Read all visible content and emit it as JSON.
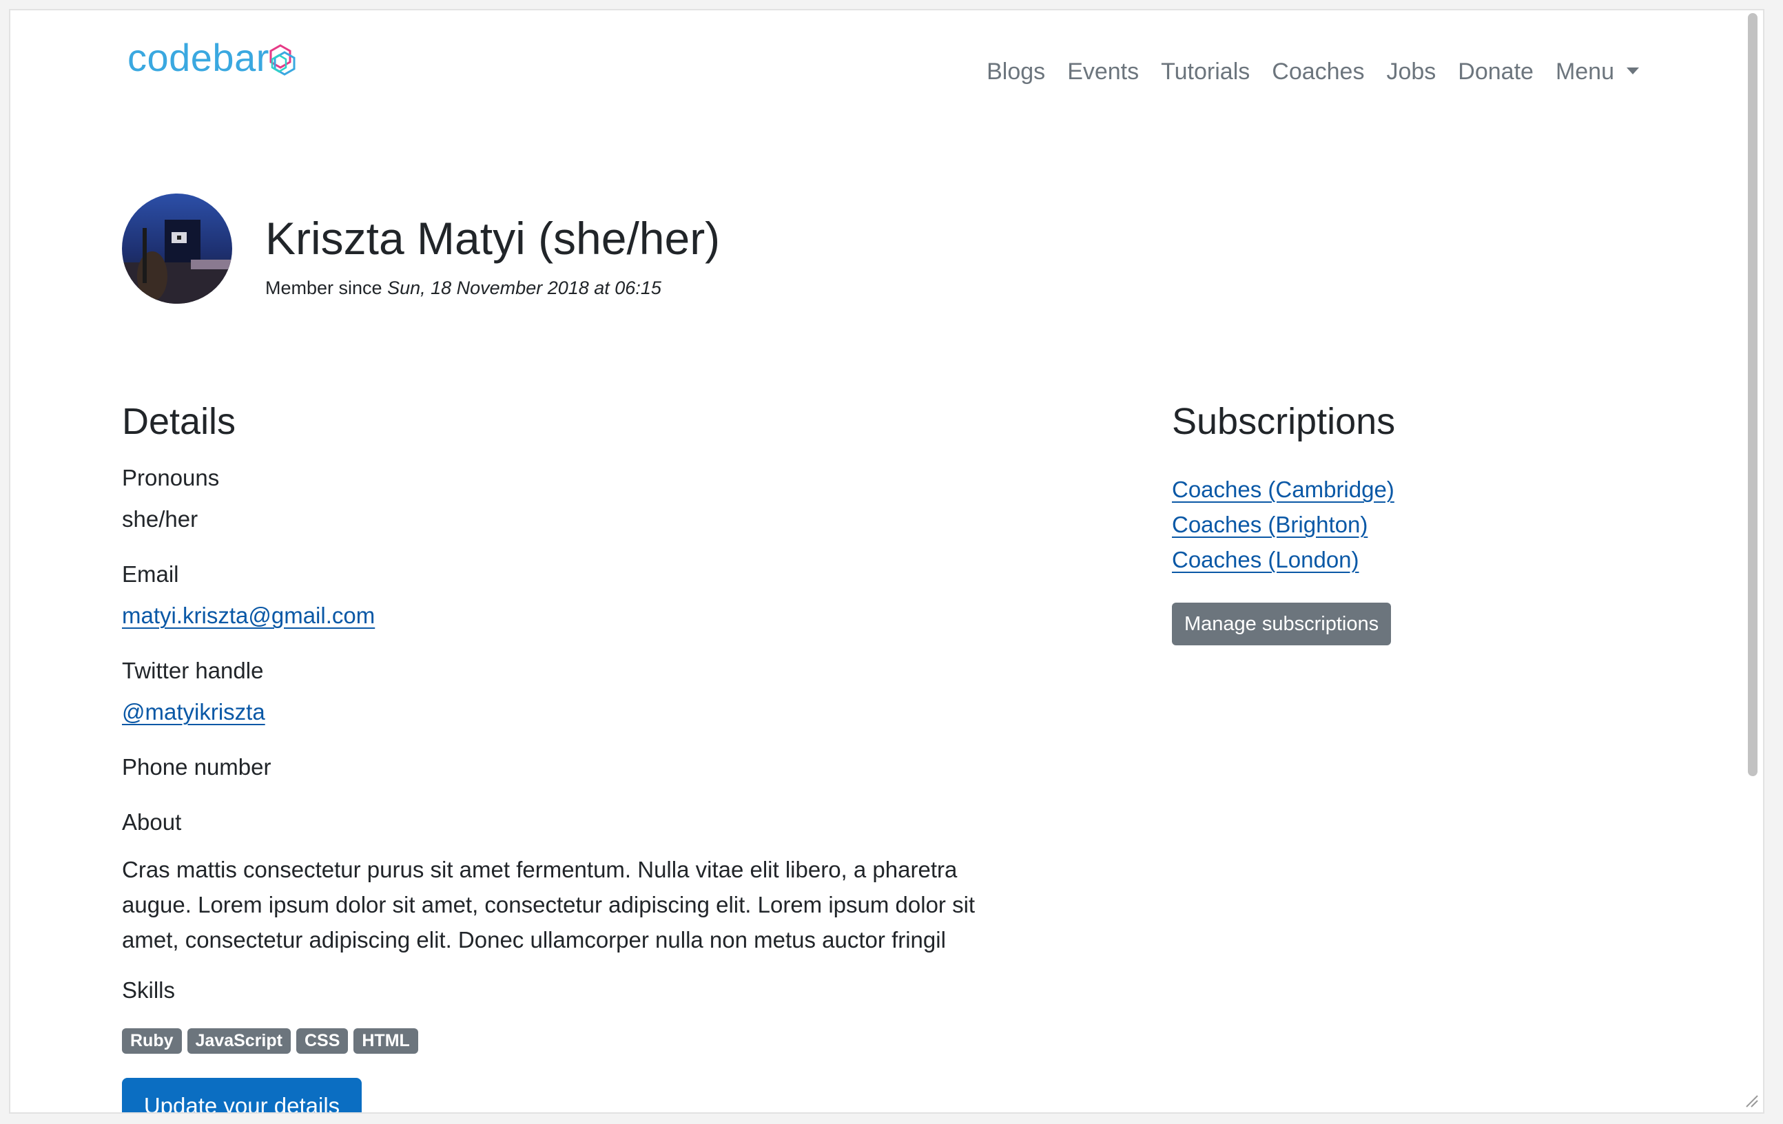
{
  "brand": {
    "logo_text": "codebar"
  },
  "nav": {
    "items": [
      "Blogs",
      "Events",
      "Tutorials",
      "Coaches",
      "Jobs",
      "Donate"
    ],
    "menu_label": "Menu"
  },
  "profile": {
    "name": "Kriszta Matyi (she/her)",
    "member_since_label": "Member since",
    "member_since_date": "Sun, 18 November 2018 at 06:15"
  },
  "details": {
    "title": "Details",
    "pronouns_label": "Pronouns",
    "pronouns_value": "she/her",
    "email_label": "Email",
    "email_value": "matyi.kriszta@gmail.com",
    "twitter_label": "Twitter handle",
    "twitter_value": "@matyikriszta",
    "phone_label": "Phone number",
    "about_label": "About",
    "about_text": "Cras mattis consectetur purus sit amet fermentum. Nulla vitae elit libero, a pharetra augue. Lorem ipsum dolor sit amet, consectetur adipiscing elit. Lorem ipsum dolor sit amet, consectetur adipiscing elit. Donec ullamcorper nulla non metus auctor fringil",
    "skills_label": "Skills",
    "skills": [
      "Ruby",
      "JavaScript",
      "CSS",
      "HTML"
    ],
    "update_button": "Update your details"
  },
  "subscriptions": {
    "title": "Subscriptions",
    "items": [
      "Coaches (Cambridge)",
      "Coaches (Brighton)",
      "Coaches (London)"
    ],
    "manage_button": "Manage subscriptions"
  },
  "colors": {
    "brand_blue": "#3aa8e0",
    "link": "#0a58a6",
    "primary_button": "#0b6ec2",
    "secondary": "#6c757d"
  }
}
